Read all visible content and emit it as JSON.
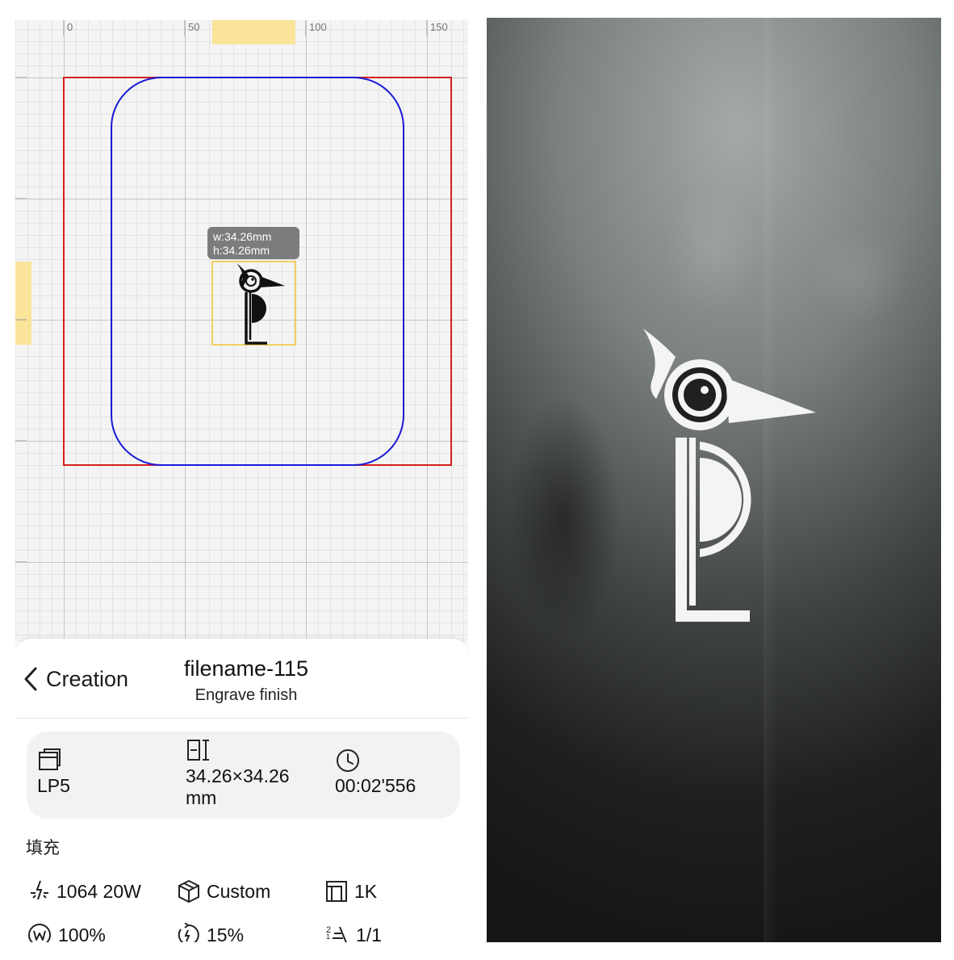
{
  "ruler": {
    "ticks": [
      "0",
      "50",
      "100",
      "150"
    ]
  },
  "selection": {
    "width_text": "w:34.26mm",
    "height_text": "h:34.26mm"
  },
  "colors": {
    "work_area": "#d81e1e",
    "material_outline": "#1a1ad6",
    "selection_box": "#f0d060",
    "ruler_highlight": "#f9e49a"
  },
  "header": {
    "back_label": "Creation",
    "title": "filename-115",
    "subtitle": "Engrave finish"
  },
  "info": {
    "device": "LP5",
    "size_value": "34.26×34.26",
    "size_unit": "mm",
    "duration": "00:02'556"
  },
  "section_label": "填充",
  "params": {
    "laser": "1064 20W",
    "material": "Custom",
    "resolution": "1K",
    "power": "100%",
    "speed": "15%",
    "passes": "1/1"
  },
  "icons": {
    "back": "chevron-left-icon",
    "device": "device-icon",
    "size": "dimensions-icon",
    "duration": "clock-icon",
    "laser": "laser-icon",
    "material": "cube-icon",
    "resolution": "resolution-icon",
    "power": "power-icon",
    "speed": "speed-icon",
    "passes": "passes-icon"
  }
}
